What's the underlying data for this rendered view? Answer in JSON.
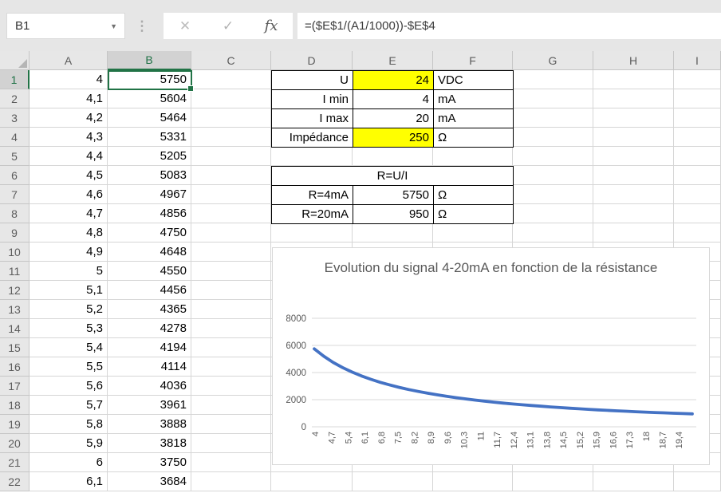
{
  "name_box": {
    "value": "B1",
    "dropdown_icon": "▼"
  },
  "formula_bar": {
    "formula": "=($E$1/(A1/1000))-$E$4",
    "cancel_icon": "✕",
    "enter_icon": "✓",
    "fx_icon": "fx",
    "separator_icon": "⋮"
  },
  "sheet": {
    "selected_cell": "B1",
    "selected_column": "B",
    "selected_row": "1",
    "column_letters": [
      "A",
      "B",
      "C",
      "D",
      "E",
      "F",
      "G",
      "H",
      "I"
    ],
    "rows": [
      {
        "n": "1",
        "a": "4",
        "b": "5750"
      },
      {
        "n": "2",
        "a": "4,1",
        "b": "5604"
      },
      {
        "n": "3",
        "a": "4,2",
        "b": "5464"
      },
      {
        "n": "4",
        "a": "4,3",
        "b": "5331"
      },
      {
        "n": "5",
        "a": "4,4",
        "b": "5205"
      },
      {
        "n": "6",
        "a": "4,5",
        "b": "5083"
      },
      {
        "n": "7",
        "a": "4,6",
        "b": "4967"
      },
      {
        "n": "8",
        "a": "4,7",
        "b": "4856"
      },
      {
        "n": "9",
        "a": "4,8",
        "b": "4750"
      },
      {
        "n": "10",
        "a": "4,9",
        "b": "4648"
      },
      {
        "n": "11",
        "a": "5",
        "b": "4550"
      },
      {
        "n": "12",
        "a": "5,1",
        "b": "4456"
      },
      {
        "n": "13",
        "a": "5,2",
        "b": "4365"
      },
      {
        "n": "14",
        "a": "5,3",
        "b": "4278"
      },
      {
        "n": "15",
        "a": "5,4",
        "b": "4194"
      },
      {
        "n": "16",
        "a": "5,5",
        "b": "4114"
      },
      {
        "n": "17",
        "a": "5,6",
        "b": "4036"
      },
      {
        "n": "18",
        "a": "5,7",
        "b": "3961"
      },
      {
        "n": "19",
        "a": "5,8",
        "b": "3888"
      },
      {
        "n": "20",
        "a": "5,9",
        "b": "3818"
      },
      {
        "n": "21",
        "a": "6",
        "b": "3750"
      },
      {
        "n": "22",
        "a": "6,1",
        "b": "3684"
      }
    ]
  },
  "params_table": {
    "rows": [
      {
        "label": "U",
        "value": "24",
        "unit": "VDC",
        "highlight": true
      },
      {
        "label": "I min",
        "value": "4",
        "unit": "mA",
        "highlight": false
      },
      {
        "label": "I max",
        "value": "20",
        "unit": "mA",
        "highlight": false
      },
      {
        "label": "Impédance",
        "value": "250",
        "unit": "Ω",
        "highlight": true
      }
    ],
    "highlight_color": "#ffff00"
  },
  "calc_table": {
    "header": "R=U/I",
    "rows": [
      {
        "label": "R=4mA",
        "value": "5750",
        "unit": "Ω"
      },
      {
        "label": "R=20mA",
        "value": "950",
        "unit": "Ω"
      }
    ]
  },
  "chart_data": {
    "type": "line",
    "title": "Evolution du signal 4-20mA en fonction de la résistance",
    "x": [
      4,
      4.4,
      4.8,
      5.2,
      5.6,
      6,
      6.4,
      6.8,
      7.2,
      7.6,
      8,
      8.4,
      8.8,
      9.2,
      9.6,
      10,
      10.4,
      10.8,
      11.2,
      11.6,
      12,
      12.4,
      12.8,
      13.2,
      13.6,
      14,
      14.4,
      14.8,
      15.2,
      15.6,
      16,
      16.4,
      16.8,
      17.2,
      17.6,
      18,
      18.4,
      18.8,
      19.2,
      19.6,
      20
    ],
    "values": [
      5750,
      5205,
      4750,
      4365,
      4036,
      3750,
      3500,
      3279,
      3083,
      2908,
      2750,
      2607,
      2477,
      2359,
      2250,
      2150,
      2058,
      1972,
      1893,
      1819,
      1750,
      1685,
      1625,
      1568,
      1515,
      1464,
      1417,
      1372,
      1329,
      1288,
      1250,
      1213,
      1179,
      1145,
      1114,
      1083,
      1054,
      1027,
      1000,
      974,
      950
    ],
    "x_tick_labels": [
      "4",
      "4,7",
      "5,4",
      "6,1",
      "6,8",
      "7,5",
      "8,2",
      "8,9",
      "9,6",
      "10,3",
      "11",
      "11,7",
      "12,4",
      "13,1",
      "13,8",
      "14,5",
      "15,2",
      "15,9",
      "16,6",
      "17,3",
      "18",
      "18,7",
      "19,4"
    ],
    "y_ticks": [
      0,
      2000,
      4000,
      6000,
      8000
    ],
    "ylim": [
      0,
      8000
    ],
    "xlim": [
      4,
      20
    ],
    "xlabel": "",
    "ylabel": "",
    "grid": "on",
    "legend": "none",
    "line_color": "#4472c4",
    "gridline_color": "#d9d9d9",
    "axis_text_color": "#595959"
  },
  "colors": {
    "accent_green": "#217346",
    "highlight_yellow": "#ffff00",
    "chrome_gray": "#e6e6e6"
  }
}
